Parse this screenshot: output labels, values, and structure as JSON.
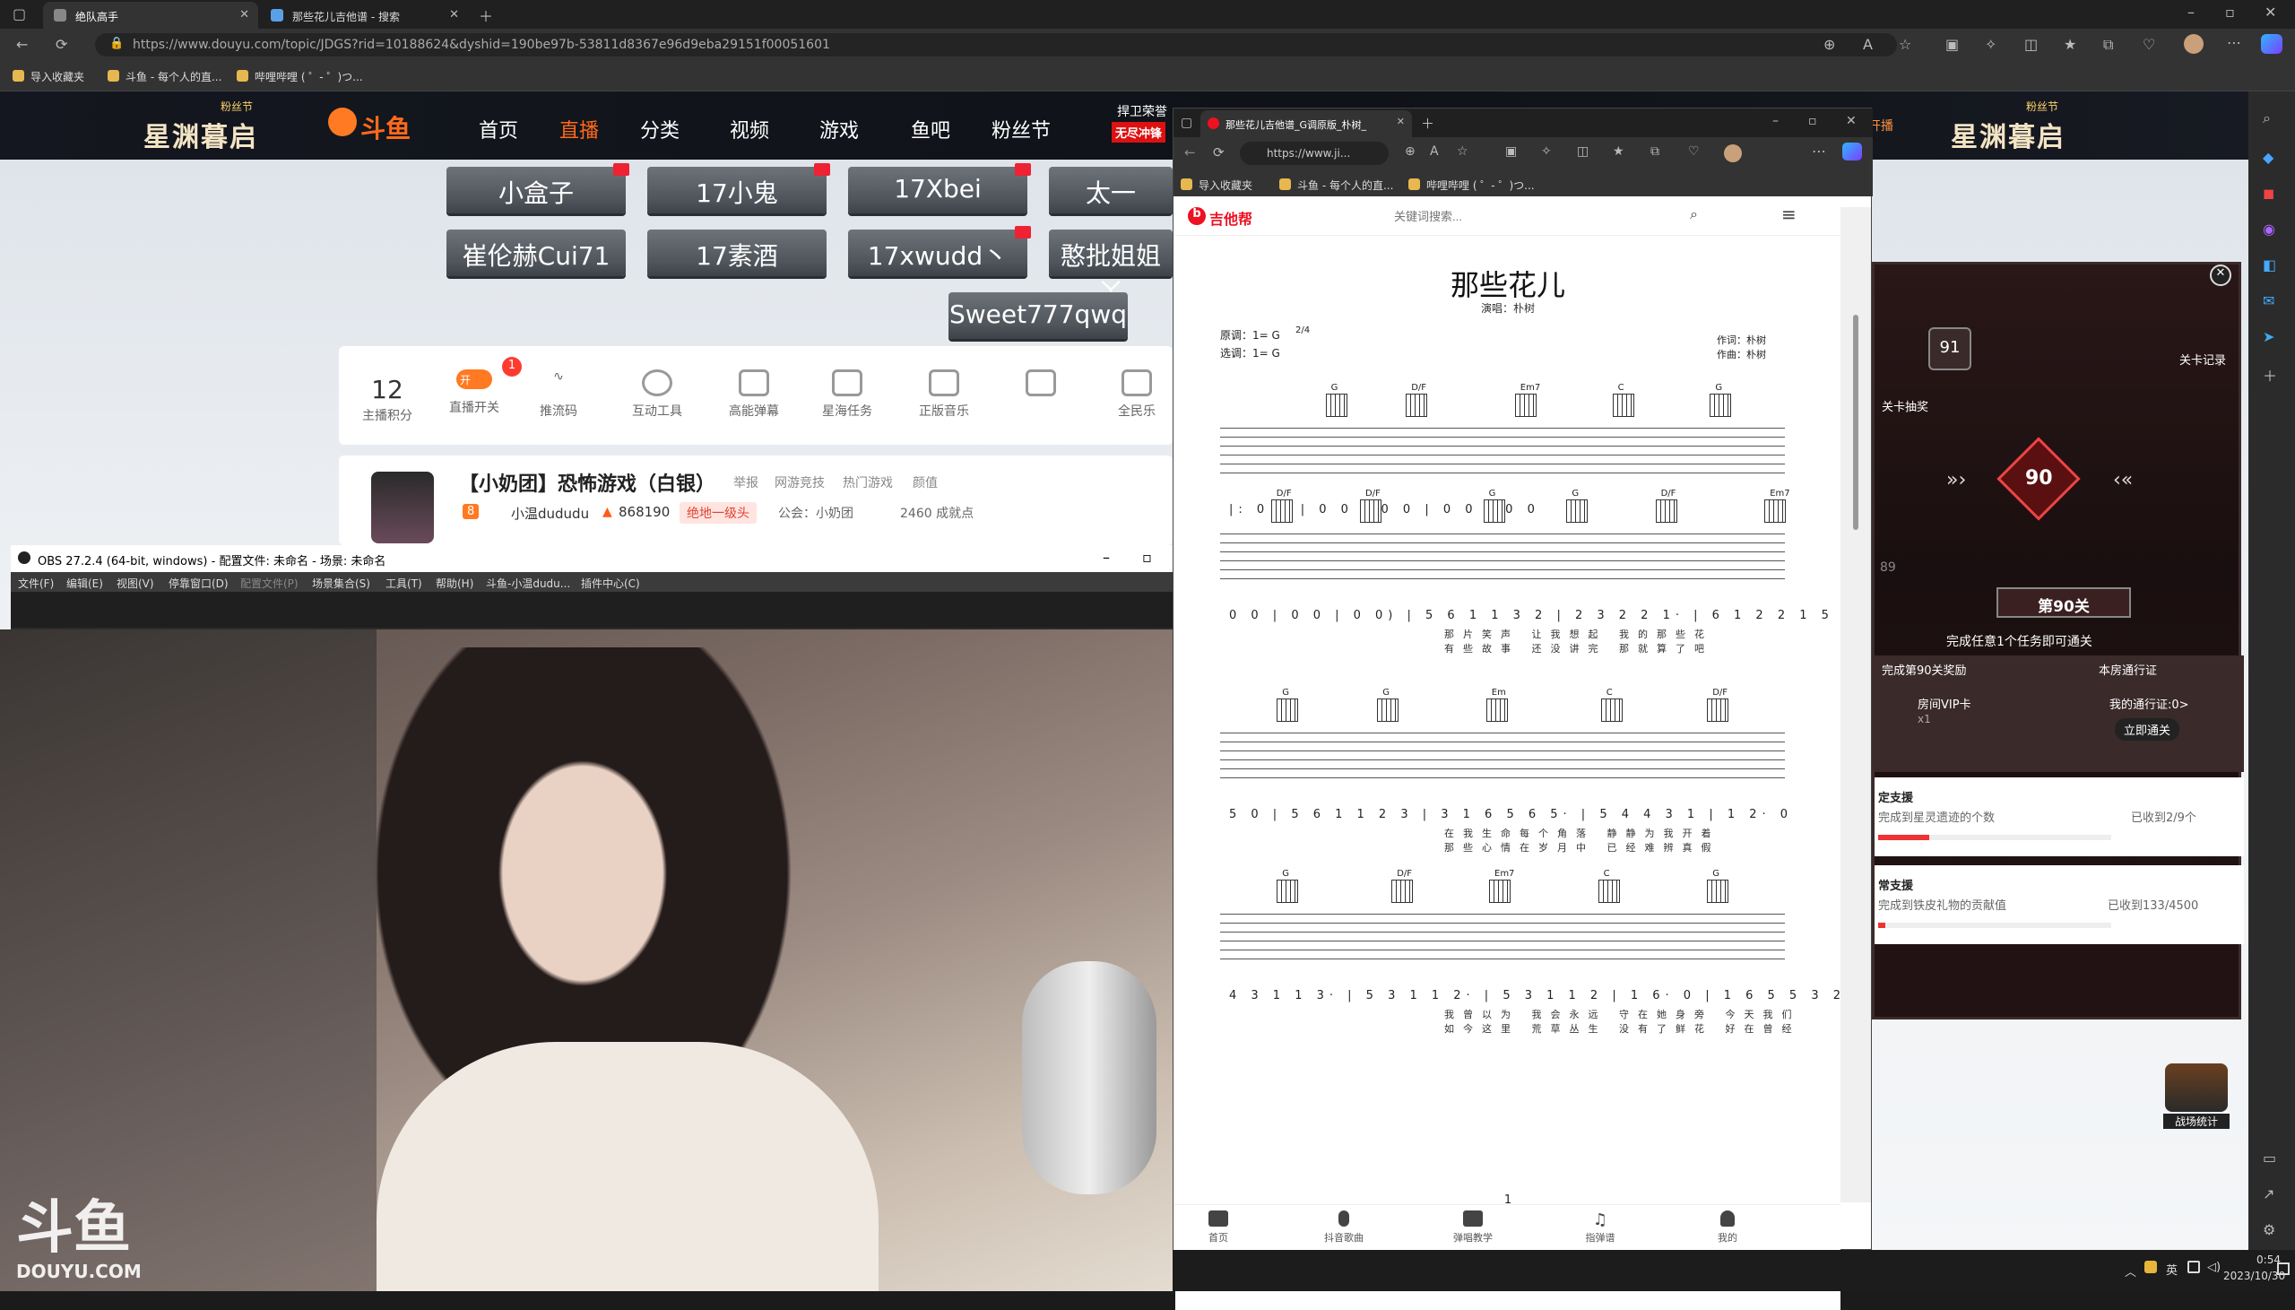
{
  "browser": {
    "tabs": [
      {
        "label": "绝队高手",
        "active": true
      },
      {
        "label": "那些花儿吉他谱 - 搜索",
        "active": false
      }
    ],
    "url": "https://www.douyu.com/topic/JDGS?rid=10188624&dyshid=190be97b-53811d8367e96d9eba29151f00051601",
    "bookmarks": [
      "导入收藏夹",
      "斗鱼 - 每个人的直...",
      "哔哩哔哩 ( ゜- ゜)つ..."
    ]
  },
  "douyu": {
    "nav": [
      "首页",
      "直播",
      "分类",
      "视频",
      "游戏",
      "鱼吧",
      "粉丝节"
    ],
    "active_nav": "直播",
    "banner_left": "星渊暮启",
    "banner_right": "星渊暮启",
    "banner_tag": "粉丝节",
    "promo": "捍卫荣誉",
    "promo_sub": "无尽冲锋",
    "open_btn": "开播",
    "gift_row1": [
      "小盒子",
      "17小鬼",
      "17Xbei",
      "太一"
    ],
    "gift_row2": [
      "崔伦赫Cui71",
      "17素酒",
      "17xwudd丶",
      "憨批姐姐ㄚ"
    ],
    "gift_row3": [
      "Sweet777qwq"
    ],
    "score_value": "12",
    "score_label": "主播积分",
    "tools": [
      "直播开关",
      "推流码",
      "互动工具",
      "高能弹幕",
      "星海任务",
      "正版音乐",
      "",
      "全民乐"
    ],
    "live_badge": "开",
    "notice_count": "1",
    "room_title": "【小奶团】恐怖游戏（白银）",
    "room_tags": [
      "举报",
      "网游竞技",
      "热门游戏",
      "颜值"
    ],
    "streamer": "小温dududu",
    "level": "8",
    "heat": "868190",
    "rank": "绝地一级头",
    "announcement": "公会：小奶团",
    "achieve": "2460 成就点"
  },
  "mission": {
    "level_current": "90",
    "level_next": "91",
    "level_prev": "89",
    "stage_title": "第90关",
    "stage_hint": "完成任意1个任务即可通关",
    "record": "关卡记录",
    "lottery": "关卡抽奖",
    "reward_tab": "完成第90关奖励",
    "pass_tab": "本房通行证",
    "vip_card": "房间VIP卡",
    "vip_count": "x1",
    "pass_text": "我的通行证:0>",
    "pass_btn": "立即通关",
    "task1_title": "定支援",
    "task1_desc": "完成到星灵遗迹的个数",
    "task1_progress": "已收到2/9个",
    "task1_ratio": 0.22,
    "task2_title": "常支援",
    "task2_desc": "完成到铁皮礼物的贡献值",
    "task2_progress": "已收到133/4500",
    "task2_ratio": 0.03,
    "side_badge": "战场统计"
  },
  "obs": {
    "title": "OBS 27.2.4 (64-bit, windows) - 配置文件: 未命名 - 场景: 未命名",
    "menu": [
      "文件(F)",
      "编辑(E)",
      "视图(V)",
      "停靠窗口(D)",
      "配置文件(P)",
      "场景集合(S)",
      "工具(T)",
      "帮助(H)",
      "斗鱼-小温dudu...",
      "插件中心(C)"
    ],
    "watermark": "斗鱼",
    "watermark_sub": "DOUYU.COM"
  },
  "tabsite": {
    "tab_label": "那些花儿吉他谱_G调原版_朴树_",
    "url": "https://www.ji...",
    "bookmarks": [
      "导入收藏夹",
      "斗鱼 - 每个人的直...",
      "哔哩哔哩 ( ゜- ゜)つ..."
    ],
    "logo": "吉他帮",
    "search_placeholder": "关键词搜索...",
    "song_title": "那些花儿",
    "singer": "演唱：朴树",
    "original_key": "原调：1= G",
    "time_sig": "2/4",
    "chosen_key": "选调：1= G",
    "lyricist": "作词：朴树",
    "composer": "作曲：朴树",
    "chords_row1": [
      "G",
      "D/F",
      "Em7",
      "C",
      "G"
    ],
    "chords_row2": [
      "D/F",
      "D/F",
      "G",
      "G",
      "D/F",
      "Em7"
    ],
    "chords_row3": [
      "G",
      "G",
      "Em",
      "C",
      "D/F"
    ],
    "chords_row4": [
      "G",
      "D/F",
      "Em7",
      "C",
      "G"
    ],
    "nums_row1": "|: 0   0 |  0   0 |  0   0 |  0   0 |  0   0",
    "nums_row2": "0   0 | 0   0 | 0   0) | 5 6 1 1 3 2 | 2 3 2 2 1· | 6 1 2 2 1 5",
    "lyrics_row2a": "那片笑声   让我想起   我的那些花",
    "lyrics_row2b": "有些故事   还没讲完   那就算了吧",
    "nums_row3": "5   0 | 5 6 1 1 2 3 | 3 1 6 5 6 5· | 5 4 4 3 1 | 1 2·   0",
    "lyrics_row3a": "在我生命每个角落   静静为我开着",
    "lyrics_row3b": "那些心情在岁月中   已经难辨真假",
    "nums_row4": "4 3 1 1 3· | 5 3 1 1 2· | 5 3 1 1 2 | 1 6·   0 | 1 6 5 5 3 2",
    "lyrics_row4a": "我曾以为   我会永远   守在她身旁   今天我们",
    "lyrics_row4b": "如今这里   荒草丛生   没有了鲜花   好在曾经",
    "page_number": "1",
    "bottom_nav": [
      "首页",
      "抖音歌曲",
      "弹唱教学",
      "指弹谱",
      "我的"
    ]
  },
  "taskbar": {
    "ime": "英",
    "time": "0:54",
    "date": "2023/10/30"
  }
}
